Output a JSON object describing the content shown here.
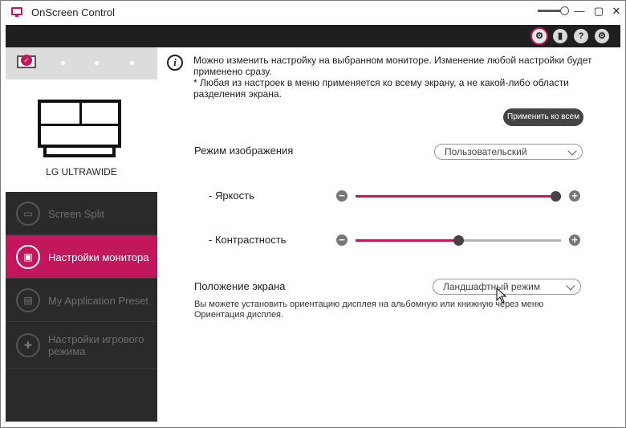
{
  "window": {
    "title": "OnScreen Control"
  },
  "titlebar_buttons": {
    "minimize": "—",
    "maximize": "▢",
    "close": "✕"
  },
  "toolbar": {
    "buttons": [
      {
        "icon": "display-sync-icon",
        "glyph": "⚙"
      },
      {
        "icon": "battery-icon",
        "glyph": "▮"
      },
      {
        "icon": "help-icon",
        "glyph": "?"
      },
      {
        "icon": "settings-icon",
        "glyph": "⚙"
      }
    ]
  },
  "sidebar": {
    "monitor_check_glyph": "✓",
    "monitor_name": "LG ULTRAWIDE",
    "items": [
      {
        "label": "Screen Split",
        "icon": "screen-split-icon",
        "glyph": "▭",
        "active": false
      },
      {
        "label": "Настройки монитора",
        "icon": "monitor-settings-icon",
        "glyph": "▣",
        "active": true
      },
      {
        "label": "My Application Preset",
        "icon": "app-preset-icon",
        "glyph": "▤",
        "active": false
      },
      {
        "label": "Настройки игрового режима",
        "icon": "gamepad-icon",
        "glyph": "✚",
        "active": false
      }
    ]
  },
  "main": {
    "info_glyph": "i",
    "info_line1": "Можно изменить настройку на выбранном мониторе. Изменение любой настройки будет применено сразу.",
    "info_line2": "* Любая из настроек в меню применяется ко всему экрану, а не какой-либо области разделения экрана.",
    "apply_all_label": "Применить ко всем",
    "picture_mode": {
      "label": "Режим изображения",
      "value": "Пользовательский"
    },
    "brightness": {
      "label": "- Яркость",
      "value_percent": 100
    },
    "contrast": {
      "label": "- Контрастность",
      "value_percent": 50
    },
    "slider_minus": "−",
    "slider_plus": "+",
    "orientation": {
      "label": "Положение экрана",
      "value": "Ландшафтный режим",
      "description": "Вы можете установить ориентацию дисплея на альбомную или книжную через меню Ориентация дисплея."
    }
  },
  "colors": {
    "accent": "#c2185b",
    "sidebar_bg": "#2a2a2a",
    "toolbar_bg": "#1f1f1f"
  }
}
